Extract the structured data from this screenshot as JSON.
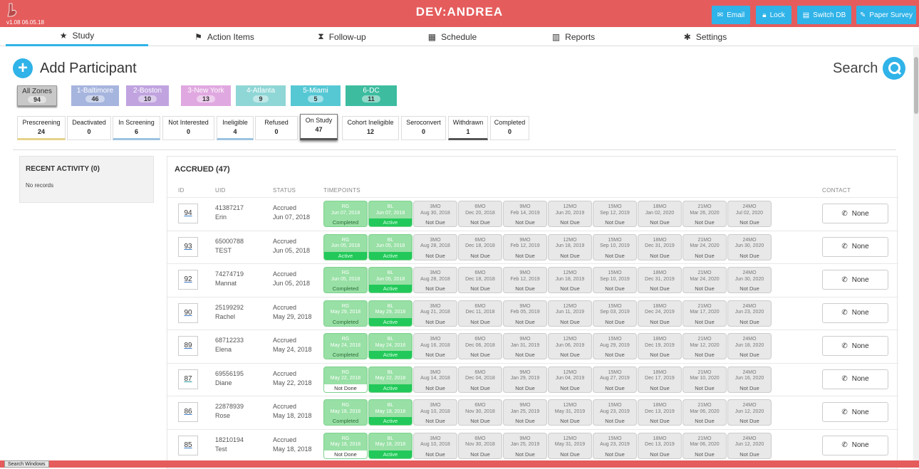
{
  "topbar": {
    "version": "v1.08 06.05.18",
    "title": "DEV:ANDREA",
    "buttons": [
      "Email",
      "Lock",
      "Switch DB",
      "Paper Survey"
    ],
    "color": "#e55c5c",
    "accent": "#2fb3e8"
  },
  "nav": {
    "tabs": [
      "Study",
      "Action Items",
      "Follow-up",
      "Schedule",
      "Reports",
      "Settings"
    ],
    "active": "Study"
  },
  "add_participant": "Add Participant",
  "search_label": "Search",
  "zones": [
    {
      "label": "All Zones",
      "count": "94",
      "color": "#c8c8c8"
    },
    {
      "label": "1-Baltimore",
      "count": "46",
      "color": "#a6b5de"
    },
    {
      "label": "2-Boston",
      "count": "10",
      "color": "#c0a3df"
    },
    {
      "label": "3-New York",
      "count": "13",
      "color": "#e0a8e0"
    },
    {
      "label": "4-Atlanta",
      "count": "9",
      "color": "#8fd6d6"
    },
    {
      "label": "5-Miami",
      "count": "5",
      "color": "#56c8d4"
    },
    {
      "label": "6-DC",
      "count": "11",
      "color": "#3dbca0"
    }
  ],
  "statuses": [
    {
      "label": "Prescreening",
      "count": "24"
    },
    {
      "label": "Deactivated",
      "count": "0"
    },
    {
      "label": "In Screening",
      "count": "6"
    },
    {
      "label": "Not Interested",
      "count": "0"
    },
    {
      "label": "Ineligible",
      "count": "4"
    },
    {
      "label": "Refused",
      "count": "0"
    },
    {
      "label": "On Study",
      "count": "47"
    },
    {
      "label": "Cohort Ineligible",
      "count": "12"
    },
    {
      "label": "Seroconvert",
      "count": "0"
    },
    {
      "label": "Withdrawn",
      "count": "1"
    },
    {
      "label": "Completed",
      "count": "0"
    }
  ],
  "recent": {
    "title": "RECENT ACTIVITY (0)",
    "empty": "No records"
  },
  "accrued": {
    "title": "ACCRUED (47)",
    "headers": [
      "ID",
      "UID",
      "STATUS",
      "TIMEPOINTS",
      "CONTACT"
    ],
    "tp_labels": [
      "RG",
      "BL",
      "3MO",
      "6MO",
      "9MO",
      "12MO",
      "15MO",
      "18MO",
      "21MO",
      "24MO"
    ],
    "rows": [
      {
        "id": "94",
        "uid": "41387217",
        "name": "Erin",
        "status": "Accrued",
        "date": "Jun 07, 2018",
        "tp": [
          [
            "Jun 07, 2018",
            "Completed",
            "done"
          ],
          [
            "Jun 07, 2018",
            "Active",
            "active"
          ],
          [
            "Aug 30, 2018",
            "Not Due",
            ""
          ],
          [
            "Dec 20, 2018",
            "Not Due",
            ""
          ],
          [
            "Feb 14, 2019",
            "Not Due",
            ""
          ],
          [
            "Jun 20, 2019",
            "Not Due",
            ""
          ],
          [
            "Sep 12, 2019",
            "Not Due",
            ""
          ],
          [
            "Jan 02, 2020",
            "Not Due",
            ""
          ],
          [
            "Mar 26, 2020",
            "Not Due",
            ""
          ],
          [
            "Jul 02, 2020",
            "Not Due",
            ""
          ]
        ],
        "contact": "None"
      },
      {
        "id": "93",
        "uid": "65000788",
        "name": "TEST",
        "status": "Accrued",
        "date": "Jun 05, 2018",
        "tp": [
          [
            "Jun 05, 2018",
            "Active",
            "active"
          ],
          [
            "Jun 05, 2018",
            "Active",
            "active"
          ],
          [
            "Aug 28, 2018",
            "Not Due",
            ""
          ],
          [
            "Dec 18, 2018",
            "Not Due",
            ""
          ],
          [
            "Feb 12, 2019",
            "Not Due",
            ""
          ],
          [
            "Jun 18, 2019",
            "Not Due",
            ""
          ],
          [
            "Sep 10, 2019",
            "Not Due",
            ""
          ],
          [
            "Dec 31, 2019",
            "Not Due",
            ""
          ],
          [
            "Mar 24, 2020",
            "Not Due",
            ""
          ],
          [
            "Jun 30, 2020",
            "Not Due",
            ""
          ]
        ],
        "contact": "None"
      },
      {
        "id": "92",
        "uid": "74274719",
        "name": "Mannat",
        "status": "Accrued",
        "date": "Jun 05, 2018",
        "tp": [
          [
            "Jun 05, 2018",
            "Completed",
            "done"
          ],
          [
            "Jun 05, 2018",
            "Active",
            "active"
          ],
          [
            "Aug 28, 2018",
            "Not Due",
            ""
          ],
          [
            "Dec 18, 2018",
            "Not Due",
            ""
          ],
          [
            "Feb 12, 2019",
            "Not Due",
            ""
          ],
          [
            "Jun 18, 2019",
            "Not Due",
            ""
          ],
          [
            "Sep 10, 2019",
            "Not Due",
            ""
          ],
          [
            "Dec 31, 2019",
            "Not Due",
            ""
          ],
          [
            "Mar 24, 2020",
            "Not Due",
            ""
          ],
          [
            "Jun 30, 2020",
            "Not Due",
            ""
          ]
        ],
        "contact": "None"
      },
      {
        "id": "90",
        "uid": "25199292",
        "name": "Rachel",
        "status": "Accrued",
        "date": "May 29, 2018",
        "tp": [
          [
            "May 29, 2018",
            "Completed",
            "done"
          ],
          [
            "May 29, 2018",
            "Active",
            "active"
          ],
          [
            "Aug 21, 2018",
            "Not Due",
            ""
          ],
          [
            "Dec 11, 2018",
            "Not Due",
            ""
          ],
          [
            "Feb 05, 2019",
            "Not Due",
            ""
          ],
          [
            "Jun 11, 2019",
            "Not Due",
            ""
          ],
          [
            "Sep 03, 2019",
            "Not Due",
            ""
          ],
          [
            "Dec 24, 2019",
            "Not Due",
            ""
          ],
          [
            "Mar 17, 2020",
            "Not Due",
            ""
          ],
          [
            "Jun 23, 2020",
            "Not Due",
            ""
          ]
        ],
        "contact": "None"
      },
      {
        "id": "89",
        "uid": "68712233",
        "name": "Elena",
        "status": "Accrued",
        "date": "May 24, 2018",
        "tp": [
          [
            "May 24, 2018",
            "Completed",
            "done"
          ],
          [
            "May 24, 2018",
            "Active",
            "active"
          ],
          [
            "Aug 16, 2018",
            "Not Due",
            ""
          ],
          [
            "Dec 06, 2018",
            "Not Due",
            ""
          ],
          [
            "Jan 31, 2019",
            "Not Due",
            ""
          ],
          [
            "Jun 06, 2019",
            "Not Due",
            ""
          ],
          [
            "Aug 29, 2019",
            "Not Due",
            ""
          ],
          [
            "Dec 19, 2019",
            "Not Due",
            ""
          ],
          [
            "Mar 12, 2020",
            "Not Due",
            ""
          ],
          [
            "Jun 18, 2020",
            "Not Due",
            ""
          ]
        ],
        "contact": "None"
      },
      {
        "id": "87",
        "uid": "69556195",
        "name": "Diane",
        "status": "Accrued",
        "date": "May 22, 2018",
        "tp": [
          [
            "May 22, 2018",
            "Not Done",
            "notdone"
          ],
          [
            "May 22, 2018",
            "Active",
            "active"
          ],
          [
            "Aug 14, 2018",
            "Not Due",
            ""
          ],
          [
            "Dec 04, 2018",
            "Not Due",
            ""
          ],
          [
            "Jan 29, 2019",
            "Not Due",
            ""
          ],
          [
            "Jun 04, 2019",
            "Not Due",
            ""
          ],
          [
            "Aug 27, 2019",
            "Not Due",
            ""
          ],
          [
            "Dec 17, 2019",
            "Not Due",
            ""
          ],
          [
            "Mar 10, 2020",
            "Not Due",
            ""
          ],
          [
            "Jun 16, 2020",
            "Not Due",
            ""
          ]
        ],
        "contact": "None"
      },
      {
        "id": "86",
        "uid": "22878939",
        "name": "Rose",
        "status": "Accrued",
        "date": "May 18, 2018",
        "tp": [
          [
            "May 18, 2018",
            "Completed",
            "done"
          ],
          [
            "May 18, 2018",
            "Active",
            "active"
          ],
          [
            "Aug 10, 2018",
            "Not Due",
            ""
          ],
          [
            "Nov 30, 2018",
            "Not Due",
            ""
          ],
          [
            "Jan 25, 2019",
            "Not Due",
            ""
          ],
          [
            "May 31, 2019",
            "Not Due",
            ""
          ],
          [
            "Aug 23, 2019",
            "Not Due",
            ""
          ],
          [
            "Dec 13, 2019",
            "Not Due",
            ""
          ],
          [
            "Mar 06, 2020",
            "Not Due",
            ""
          ],
          [
            "Jun 12, 2020",
            "Not Due",
            ""
          ]
        ],
        "contact": "None"
      },
      {
        "id": "85",
        "uid": "18210194",
        "name": "Test",
        "status": "Accrued",
        "date": "May 18, 2018",
        "tp": [
          [
            "May 18, 2018",
            "Not Done",
            "notdone"
          ],
          [
            "May 18, 2018",
            "Active",
            "active"
          ],
          [
            "Aug 10, 2018",
            "Not Due",
            ""
          ],
          [
            "Nov 30, 2018",
            "Not Due",
            ""
          ],
          [
            "Jan 25, 2019",
            "Not Due",
            ""
          ],
          [
            "May 31, 2019",
            "Not Due",
            ""
          ],
          [
            "Aug 23, 2019",
            "Not Due",
            ""
          ],
          [
            "Dec 13, 2019",
            "Not Due",
            ""
          ],
          [
            "Mar 06, 2020",
            "Not Due",
            ""
          ],
          [
            "Jun 12, 2020",
            "Not Due",
            ""
          ]
        ],
        "contact": "None"
      }
    ]
  },
  "taskbar": "Search Windows"
}
